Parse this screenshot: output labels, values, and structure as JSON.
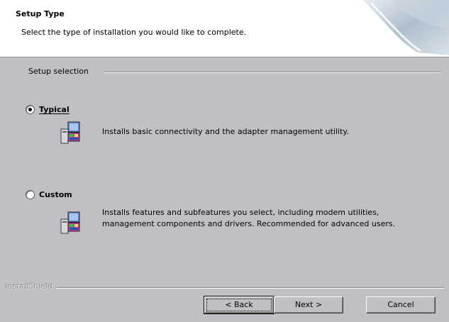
{
  "header": {
    "title": "Setup Type",
    "subtitle": "Select the type of installation you would like to complete."
  },
  "group": {
    "label": "Setup selection"
  },
  "options": [
    {
      "label": "Typical",
      "selected": true,
      "description": "Installs basic connectivity and the adapter management utility."
    },
    {
      "label": "Custom",
      "selected": false,
      "description": "Installs features and subfeatures you select, including modem utilities, management components and drivers. Recommended for advanced users."
    }
  ],
  "footer": {
    "brand": "InstallShield",
    "back_label": "< Back",
    "next_label": "Next >",
    "cancel_label": "Cancel"
  }
}
